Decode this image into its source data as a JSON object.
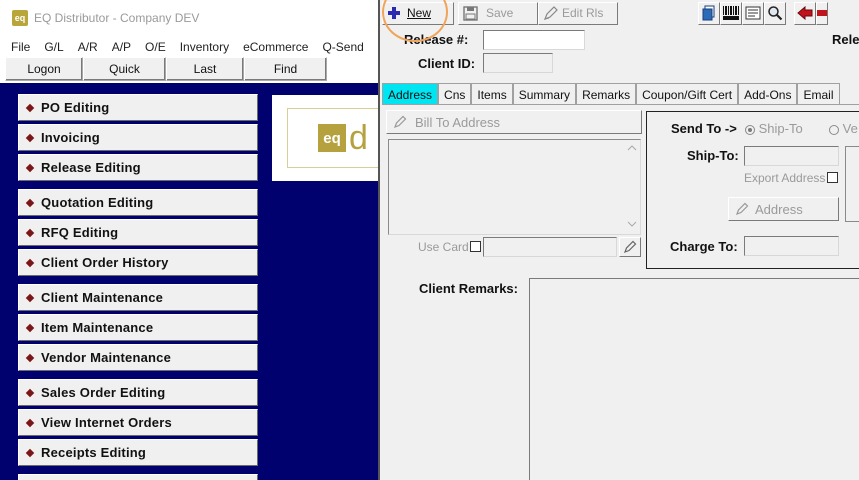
{
  "main_window": {
    "title": "EQ Distributor - Company DEV",
    "app_icon_text": "eq",
    "menu": [
      "File",
      "G/L",
      "A/R",
      "A/P",
      "O/E",
      "Inventory",
      "eCommerce",
      "Q-Send"
    ],
    "toolbar": {
      "logon": "Logon",
      "quick": "Quick",
      "last": "Last",
      "find": "Find"
    },
    "nav_items": [
      "PO Editing",
      "Invoicing",
      "Release Editing",
      "Quotation Editing",
      "RFQ Editing",
      "Client Order History",
      "Client Maintenance",
      "Item Maintenance",
      "Vendor Maintenance",
      "Sales Order Editing",
      "View Internet Orders",
      "Receipts Editing"
    ],
    "logo": {
      "mark": "eq",
      "letter": "d"
    }
  },
  "release_window": {
    "toolbar": {
      "new": "New",
      "save": "Save",
      "edit_rls": "Edit Rls"
    },
    "release_label": "Release #:",
    "release_value": "",
    "release_right_label": "Rele",
    "client_id_label": "Client ID:",
    "client_id_value": "",
    "tabs": [
      "Address",
      "Cns",
      "Items",
      "Summary",
      "Remarks",
      "Coupon/Gift Cert",
      "Add-Ons",
      "Email"
    ],
    "active_tab": "Address",
    "bill_to_button": "Bill To Address",
    "use_card_label": "Use Card",
    "send_to_label": "Send To ->",
    "ship_to_radio": "Ship-To",
    "other_radio": "Ve",
    "ship_to_label": "Ship-To:",
    "export_address_label": "Export Address",
    "address_button": "Address",
    "charge_to_label": "Charge To:",
    "client_remarks_label": "Client Remarks:"
  },
  "colors": {
    "nav_background": "#00006e",
    "active_tab": "#00e5f2",
    "highlight": "#f0a35a",
    "brand": "#b5a23f"
  }
}
